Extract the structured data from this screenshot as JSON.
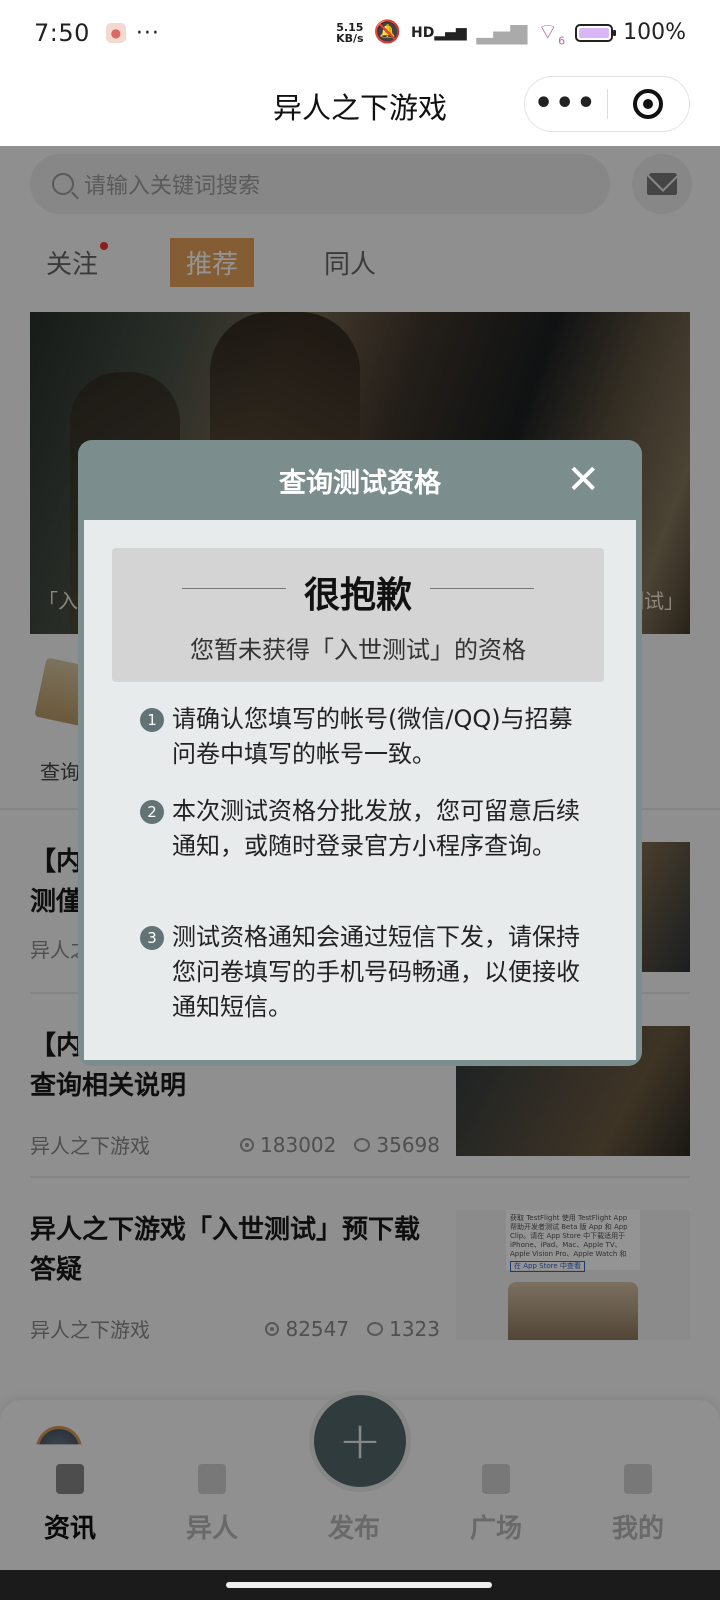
{
  "status_bar": {
    "time": "7:50",
    "more": "···",
    "speed_value": "5.15",
    "speed_unit": "KB/s",
    "hd": "HD",
    "sim": "6",
    "battery": "100%"
  },
  "nav": {
    "title": "异人之下游戏",
    "more": "•••"
  },
  "search": {
    "placeholder": "请输入关键词搜索"
  },
  "tabs": [
    {
      "label": "关注"
    },
    {
      "label": "推荐"
    },
    {
      "label": "同人"
    }
  ],
  "banner": {
    "caption_left": "「入",
    "caption_right": "测试」"
  },
  "quick_entry": {
    "label": "查询"
  },
  "articles": [
    {
      "title": "【内",
      "title2": "测僅",
      "source": "异人之"
    },
    {
      "title": "【内容资格撑落】「入世测试」资格查询相关说明",
      "source": "异人之下游戏",
      "views": "183002",
      "comments": "35698"
    },
    {
      "title": "异人之下游戏「入世测试」预下载答疑",
      "source": "异人之下游戏",
      "views": "82547",
      "comments": "1323"
    }
  ],
  "thumb_doc_text": "获取 TestFlight 使用 TestFlight App 帮助开发者测试 Beta 版 App 和 App Clip。请在 App Store 中下载适用于 iPhone、iPad、Mac、Apple TV、Apple Vision Pro、Apple Watch 和",
  "thumb_doc_button": "在 App Store 中查看",
  "tabbar": {
    "items": [
      {
        "label": "资讯"
      },
      {
        "label": "异人"
      },
      {
        "label": "发布"
      },
      {
        "label": "广场"
      },
      {
        "label": "我的"
      }
    ],
    "fab": "+"
  },
  "modal": {
    "title": "查询测试资格",
    "close": "✕",
    "sorry_title": "很抱歉",
    "sorry_subtitle": "您暂未获得「入世测试」的资格",
    "rules": [
      {
        "num": "1",
        "text": "请确认您填写的帐号(微信/QQ)与招募问卷中填写的帐号一致。"
      },
      {
        "num": "2",
        "text": "本次测试资格分批发放，您可留意后续通知，或随时登录官方小程序查询。"
      },
      {
        "num": "3",
        "text": "测试资格通知会通过短信下发，请保持您问卷填写的手机号码畅通，以便接收通知短信。"
      }
    ]
  }
}
